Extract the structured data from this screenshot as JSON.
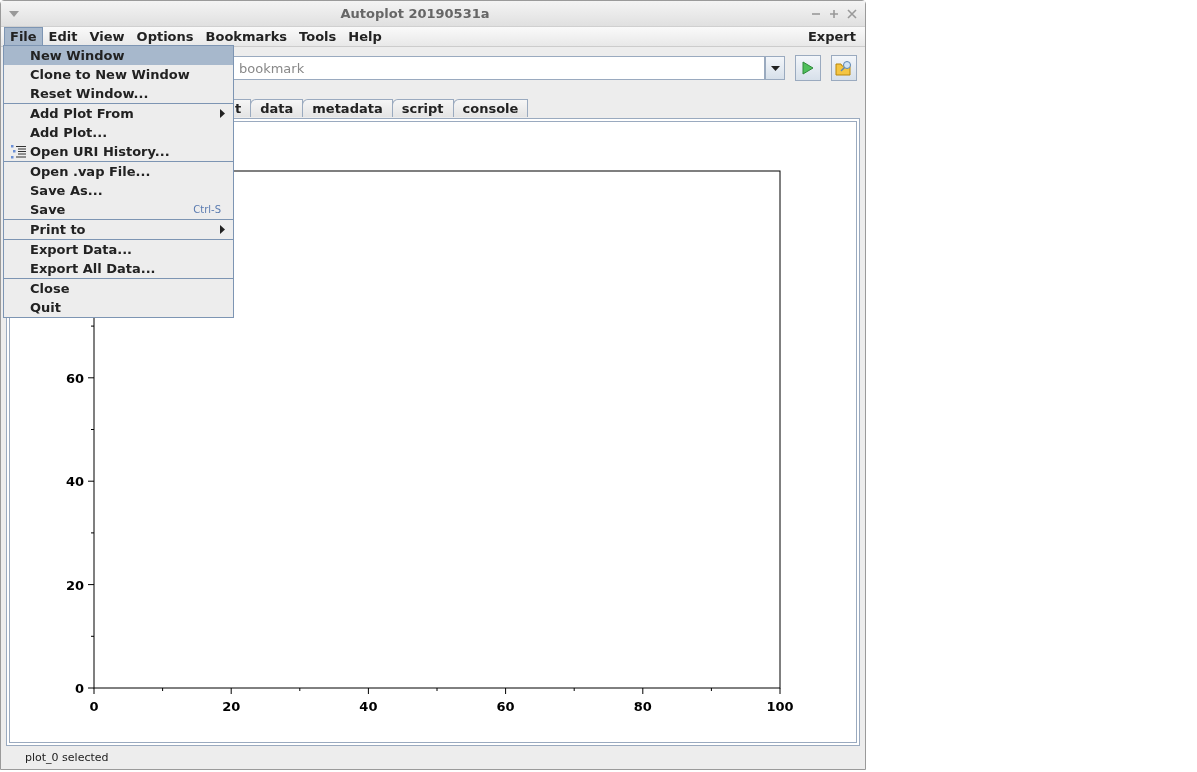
{
  "window": {
    "title": "Autoplot 20190531a"
  },
  "menu_bar": {
    "items": [
      {
        "label": "File",
        "selected": true
      },
      {
        "label": "Edit",
        "selected": false
      },
      {
        "label": "View",
        "selected": false
      },
      {
        "label": "Options",
        "selected": false
      },
      {
        "label": "Bookmarks",
        "selected": false
      },
      {
        "label": "Tools",
        "selected": false
      },
      {
        "label": "Help",
        "selected": false
      }
    ],
    "right_label": "Expert"
  },
  "file_menu": {
    "sections": [
      [
        {
          "label": "New Window",
          "kind": "item",
          "selected": true
        },
        {
          "label": "Clone to New Window",
          "kind": "item",
          "selected": false
        },
        {
          "label": "Reset Window...",
          "kind": "item",
          "selected": false
        }
      ],
      [
        {
          "label": "Add Plot From",
          "kind": "submenu",
          "selected": false
        },
        {
          "label": "Add Plot...",
          "kind": "item",
          "selected": false
        },
        {
          "label": "Open URI History...",
          "kind": "list-icon",
          "selected": false
        }
      ],
      [
        {
          "label": "Open .vap File...",
          "kind": "item",
          "selected": false
        },
        {
          "label": "Save As...",
          "kind": "item",
          "selected": false
        },
        {
          "label": "Save",
          "kind": "item",
          "selected": false,
          "shortcut": "Ctrl-S"
        }
      ],
      [
        {
          "label": "Print to",
          "kind": "submenu",
          "selected": false
        }
      ],
      [
        {
          "label": "Export Data...",
          "kind": "item",
          "selected": false
        },
        {
          "label": "Export All Data...",
          "kind": "item",
          "selected": false
        }
      ],
      [
        {
          "label": "Close",
          "kind": "item",
          "selected": false
        },
        {
          "label": "Quit",
          "kind": "item",
          "selected": false
        }
      ]
    ]
  },
  "uri_field": {
    "placeholder": "bookmark"
  },
  "tabs": [
    {
      "label": "t",
      "selected": false
    },
    {
      "label": "data",
      "selected": false
    },
    {
      "label": "metadata",
      "selected": false
    },
    {
      "label": "script",
      "selected": false
    },
    {
      "label": "console",
      "selected": false
    }
  ],
  "plot": {
    "chart_data": {
      "type": "line",
      "xlim": [
        0,
        100
      ],
      "ylim": [
        0,
        100
      ],
      "xticks": [
        0,
        20,
        40,
        60,
        80,
        100
      ],
      "yticks": [
        0,
        20,
        40,
        60
      ]
    }
  },
  "status_bar": {
    "text": "plot_0 selected"
  }
}
